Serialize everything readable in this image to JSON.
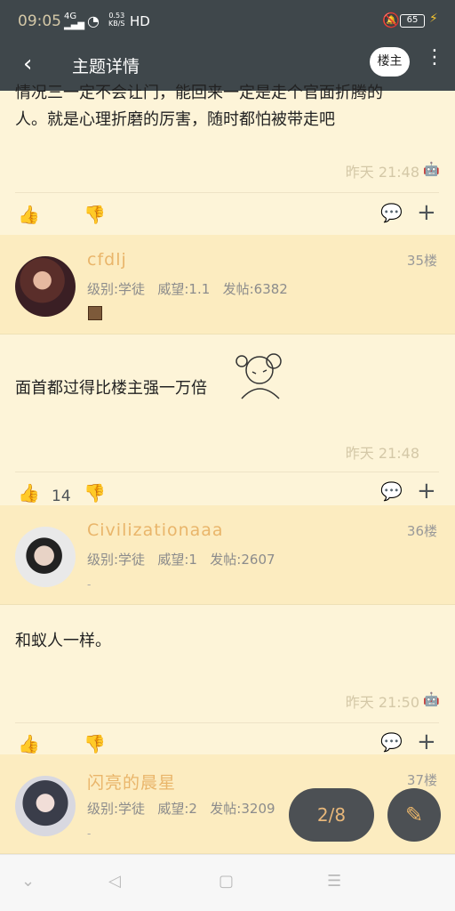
{
  "status": {
    "time": "09:05",
    "net": "4G",
    "speed_top": "0.53",
    "speed_bottom": "KB/S",
    "hd": "HD",
    "battery": "65"
  },
  "appbar": {
    "back": "‹",
    "title": "主题详情",
    "owner": "楼主",
    "more": "⋮"
  },
  "top_post": {
    "content_line1": "情况三一定不会让门，能回来一定是走个官面折腾的",
    "content_line2": "人。就是心理折磨的厉害，随时都怕被带走吧",
    "time": "昨天 21:48",
    "os_icon": "android-icon",
    "like_count": ""
  },
  "posts": [
    {
      "username": "cfdlj",
      "floor": "35楼",
      "level": "级别:学徒",
      "prestige": "威望:1.1",
      "posts": "发帖:6382",
      "content": "面首都过得比楼主强一万倍",
      "time": "昨天 21:48",
      "os_icon": "apple-icon",
      "like_count": "14"
    },
    {
      "username": "Civilizationaaa",
      "floor": "36楼",
      "level": "级别:学徒",
      "prestige": "威望:1",
      "posts": "发帖:2607",
      "dash": "-",
      "content": "和蚁人一样。",
      "time": "昨天 21:50",
      "os_icon": "android-icon",
      "like_count": ""
    },
    {
      "username": "闪亮的晨星",
      "floor": "37楼",
      "level": "级别:学徒",
      "prestige": "威望:2",
      "posts": "发帖:3209",
      "dash": "-"
    }
  ],
  "pager": "2/8",
  "icons": {
    "like": "thumbs-up-icon",
    "dislike": "thumbs-down-icon",
    "comment": "comment-icon",
    "add": "plus-icon",
    "edit": "edit-icon"
  },
  "colors": {
    "bar": "#3f474b",
    "username": "#e9b56a",
    "bg": "#fdf4d8",
    "header_bg": "#fcecc0"
  }
}
